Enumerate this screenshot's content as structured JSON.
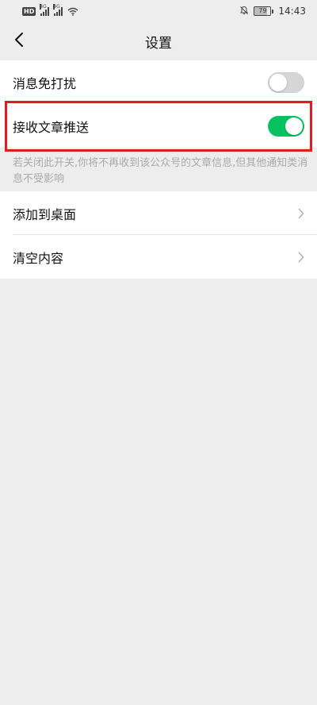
{
  "status_bar": {
    "hd_label": "HD",
    "signal1_tag": "4G",
    "signal2_tag": "4G",
    "battery_level": "79",
    "time": "14:43"
  },
  "nav": {
    "title": "设置"
  },
  "settings": {
    "mute": {
      "label": "消息免打扰",
      "enabled": false
    },
    "receive_articles": {
      "label": "接收文章推送",
      "enabled": true
    },
    "hint": "若关闭此开关,你将不再收到该公众号的文章信息,但其他通知类消息不受影响"
  },
  "actions": {
    "add_to_desktop": {
      "label": "添加到桌面"
    },
    "clear_content": {
      "label": "清空内容"
    }
  },
  "colors": {
    "toggle_on": "#07c160",
    "toggle_off": "#d6d6d6",
    "highlight": "#e01b24",
    "background": "#ededed"
  },
  "icons": {
    "back": "chevron-left-icon",
    "row_arrow": "chevron-right-icon",
    "bell_off": "bell-off-icon",
    "wifi": "wifi-icon"
  }
}
